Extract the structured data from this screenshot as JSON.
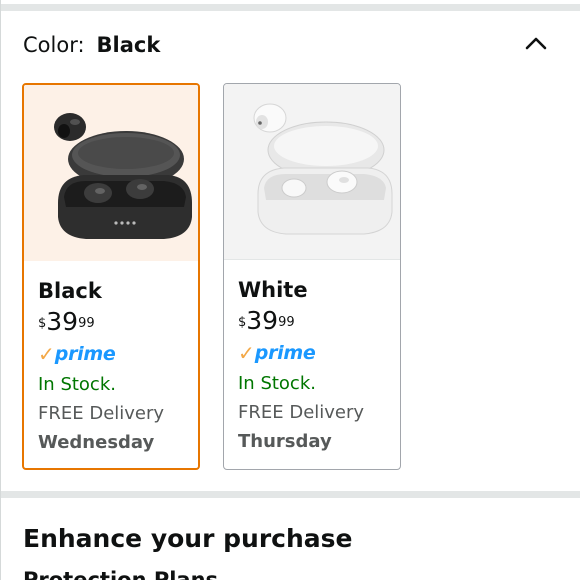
{
  "color_selector": {
    "label": "Color:",
    "selected_value": "Black",
    "collapse_icon": "chevron-up-icon"
  },
  "swatches": [
    {
      "name": "Black",
      "price_symbol": "$",
      "price_whole": "39",
      "price_fraction": "99",
      "prime_check": "✓",
      "prime_label": "prime",
      "stock": "In Stock.",
      "delivery": "FREE Delivery",
      "delivery_day": "Wednesday",
      "selected": true
    },
    {
      "name": "White",
      "price_symbol": "$",
      "price_whole": "39",
      "price_fraction": "99",
      "prime_check": "✓",
      "prime_label": "prime",
      "stock": "In Stock.",
      "delivery": "FREE Delivery",
      "delivery_day": "Thursday",
      "selected": false
    }
  ],
  "enhance": {
    "title": "Enhance your purchase",
    "subtitle": "Protection Plans"
  },
  "colors": {
    "selected_border": "#e77600",
    "in_stock": "#007600",
    "prime_blue": "#1a98ff",
    "prime_check": "#f3a847",
    "divider": "#e3e6e6"
  }
}
